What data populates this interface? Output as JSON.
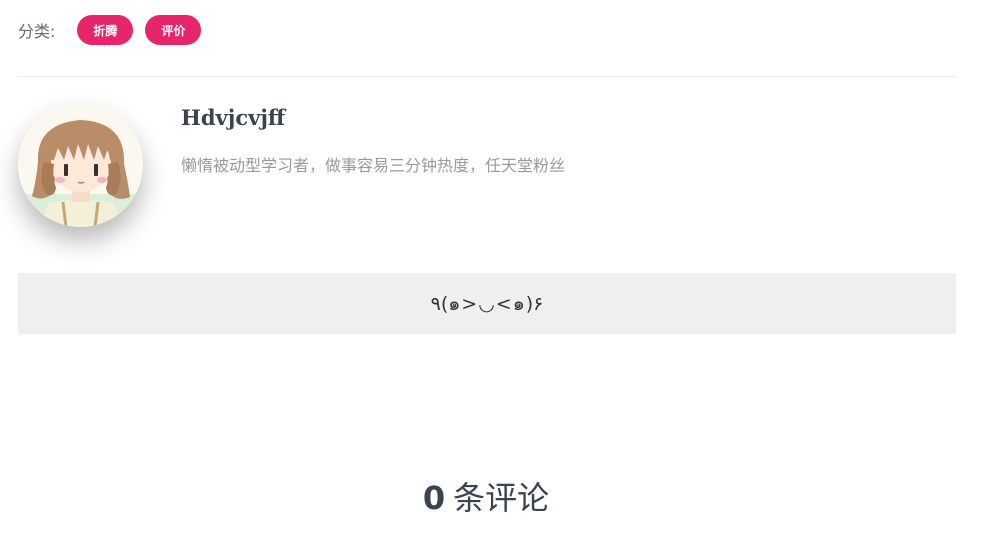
{
  "categories": {
    "label": "分类:",
    "tags": [
      {
        "label": "折腾"
      },
      {
        "label": "评价"
      }
    ],
    "tag_color": "#e7256b"
  },
  "author": {
    "name": "Hdvjcvjff",
    "bio": "懒惰被动型学习者，做事容易三分钟热度，任天堂粉丝",
    "avatar": "anime-girl-avatar"
  },
  "note": {
    "kaomoji": "٩(๑>◡<๑)۶"
  },
  "comments": {
    "count": "0",
    "label": "条评论"
  }
}
